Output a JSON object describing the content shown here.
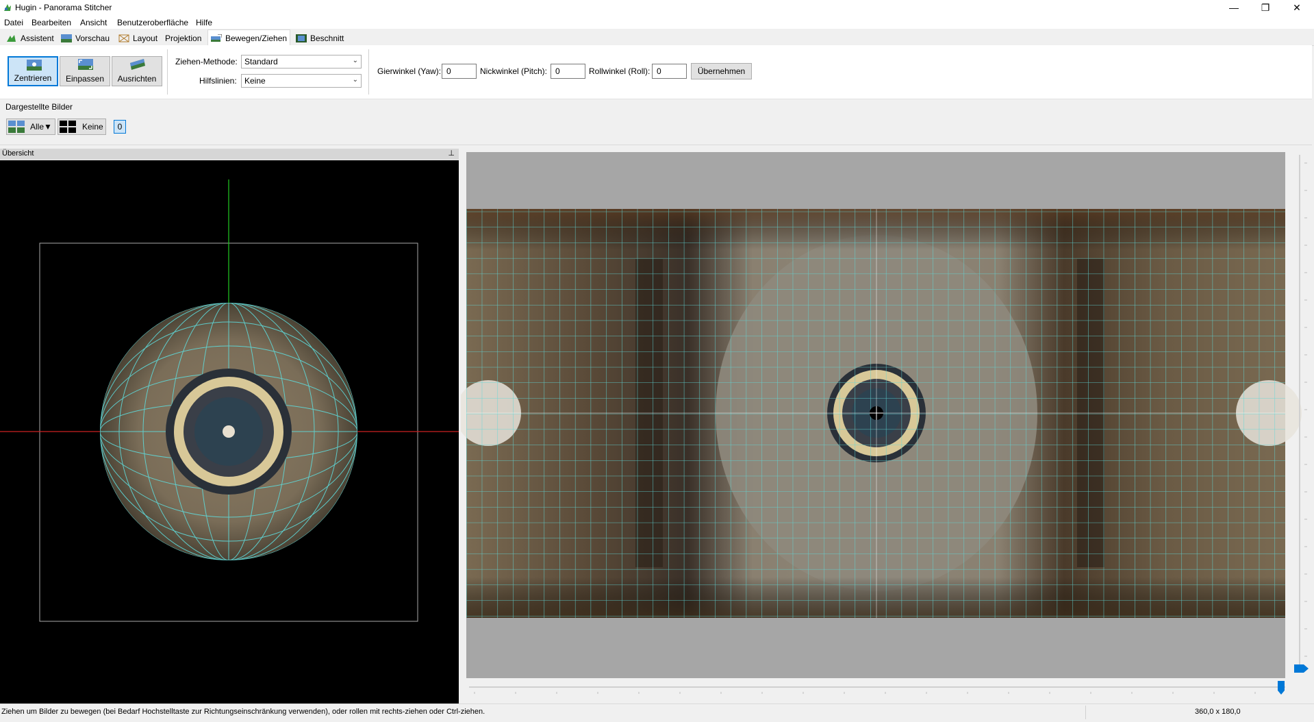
{
  "window": {
    "title": "Hugin - Panorama Stitcher",
    "minimize_glyph": "—",
    "maximize_glyph": "❐",
    "close_glyph": "✕"
  },
  "menu": {
    "items": [
      "Datei",
      "Bearbeiten",
      "Ansicht",
      "Benutzeroberfläche",
      "Hilfe"
    ]
  },
  "tabs": [
    {
      "label": "Assistent",
      "icon": "assistant-icon"
    },
    {
      "label": "Vorschau",
      "icon": "preview-icon"
    },
    {
      "label": "Layout",
      "icon": "layout-icon"
    },
    {
      "label": "Projektion",
      "icon": ""
    },
    {
      "label": "Bewegen/Ziehen",
      "icon": "move-drag-icon",
      "active": true
    },
    {
      "label": "Beschnitt",
      "icon": "crop-icon"
    }
  ],
  "toolbar": {
    "center_label": "Zentrieren",
    "fit_label": "Einpassen",
    "straighten_label": "Ausrichten",
    "drag_method_label": "Ziehen-Methode:",
    "drag_method_value": "Standard",
    "guides_label": "Hilfslinien:",
    "guides_value": "Keine",
    "yaw_label": "Gierwinkel (Yaw):",
    "yaw_value": "0",
    "pitch_label": "Nickwinkel (Pitch):",
    "pitch_value": "0",
    "roll_label": "Rollwinkel (Roll):",
    "roll_value": "0",
    "apply_label": "Übernehmen"
  },
  "displayed_images": {
    "heading": "Dargestellte Bilder",
    "all_label": "Alle▼",
    "none_label": "Keine",
    "image_number": "0"
  },
  "overview": {
    "title": "Übersicht",
    "pin_glyph": "⊥"
  },
  "status": {
    "message": "Ziehen um Bilder zu bewegen (bei Bedarf Hochstelltaste zur Richtungseinschränkung verwenden), oder rollen mit rechts-ziehen oder Ctrl-ziehen.",
    "fov": "360,0 x 180,0"
  },
  "colors": {
    "accent": "#0078d7",
    "grid": "#5fd9d9",
    "overview_bg": "#000000",
    "canvas_bg": "#a6a6a6"
  }
}
